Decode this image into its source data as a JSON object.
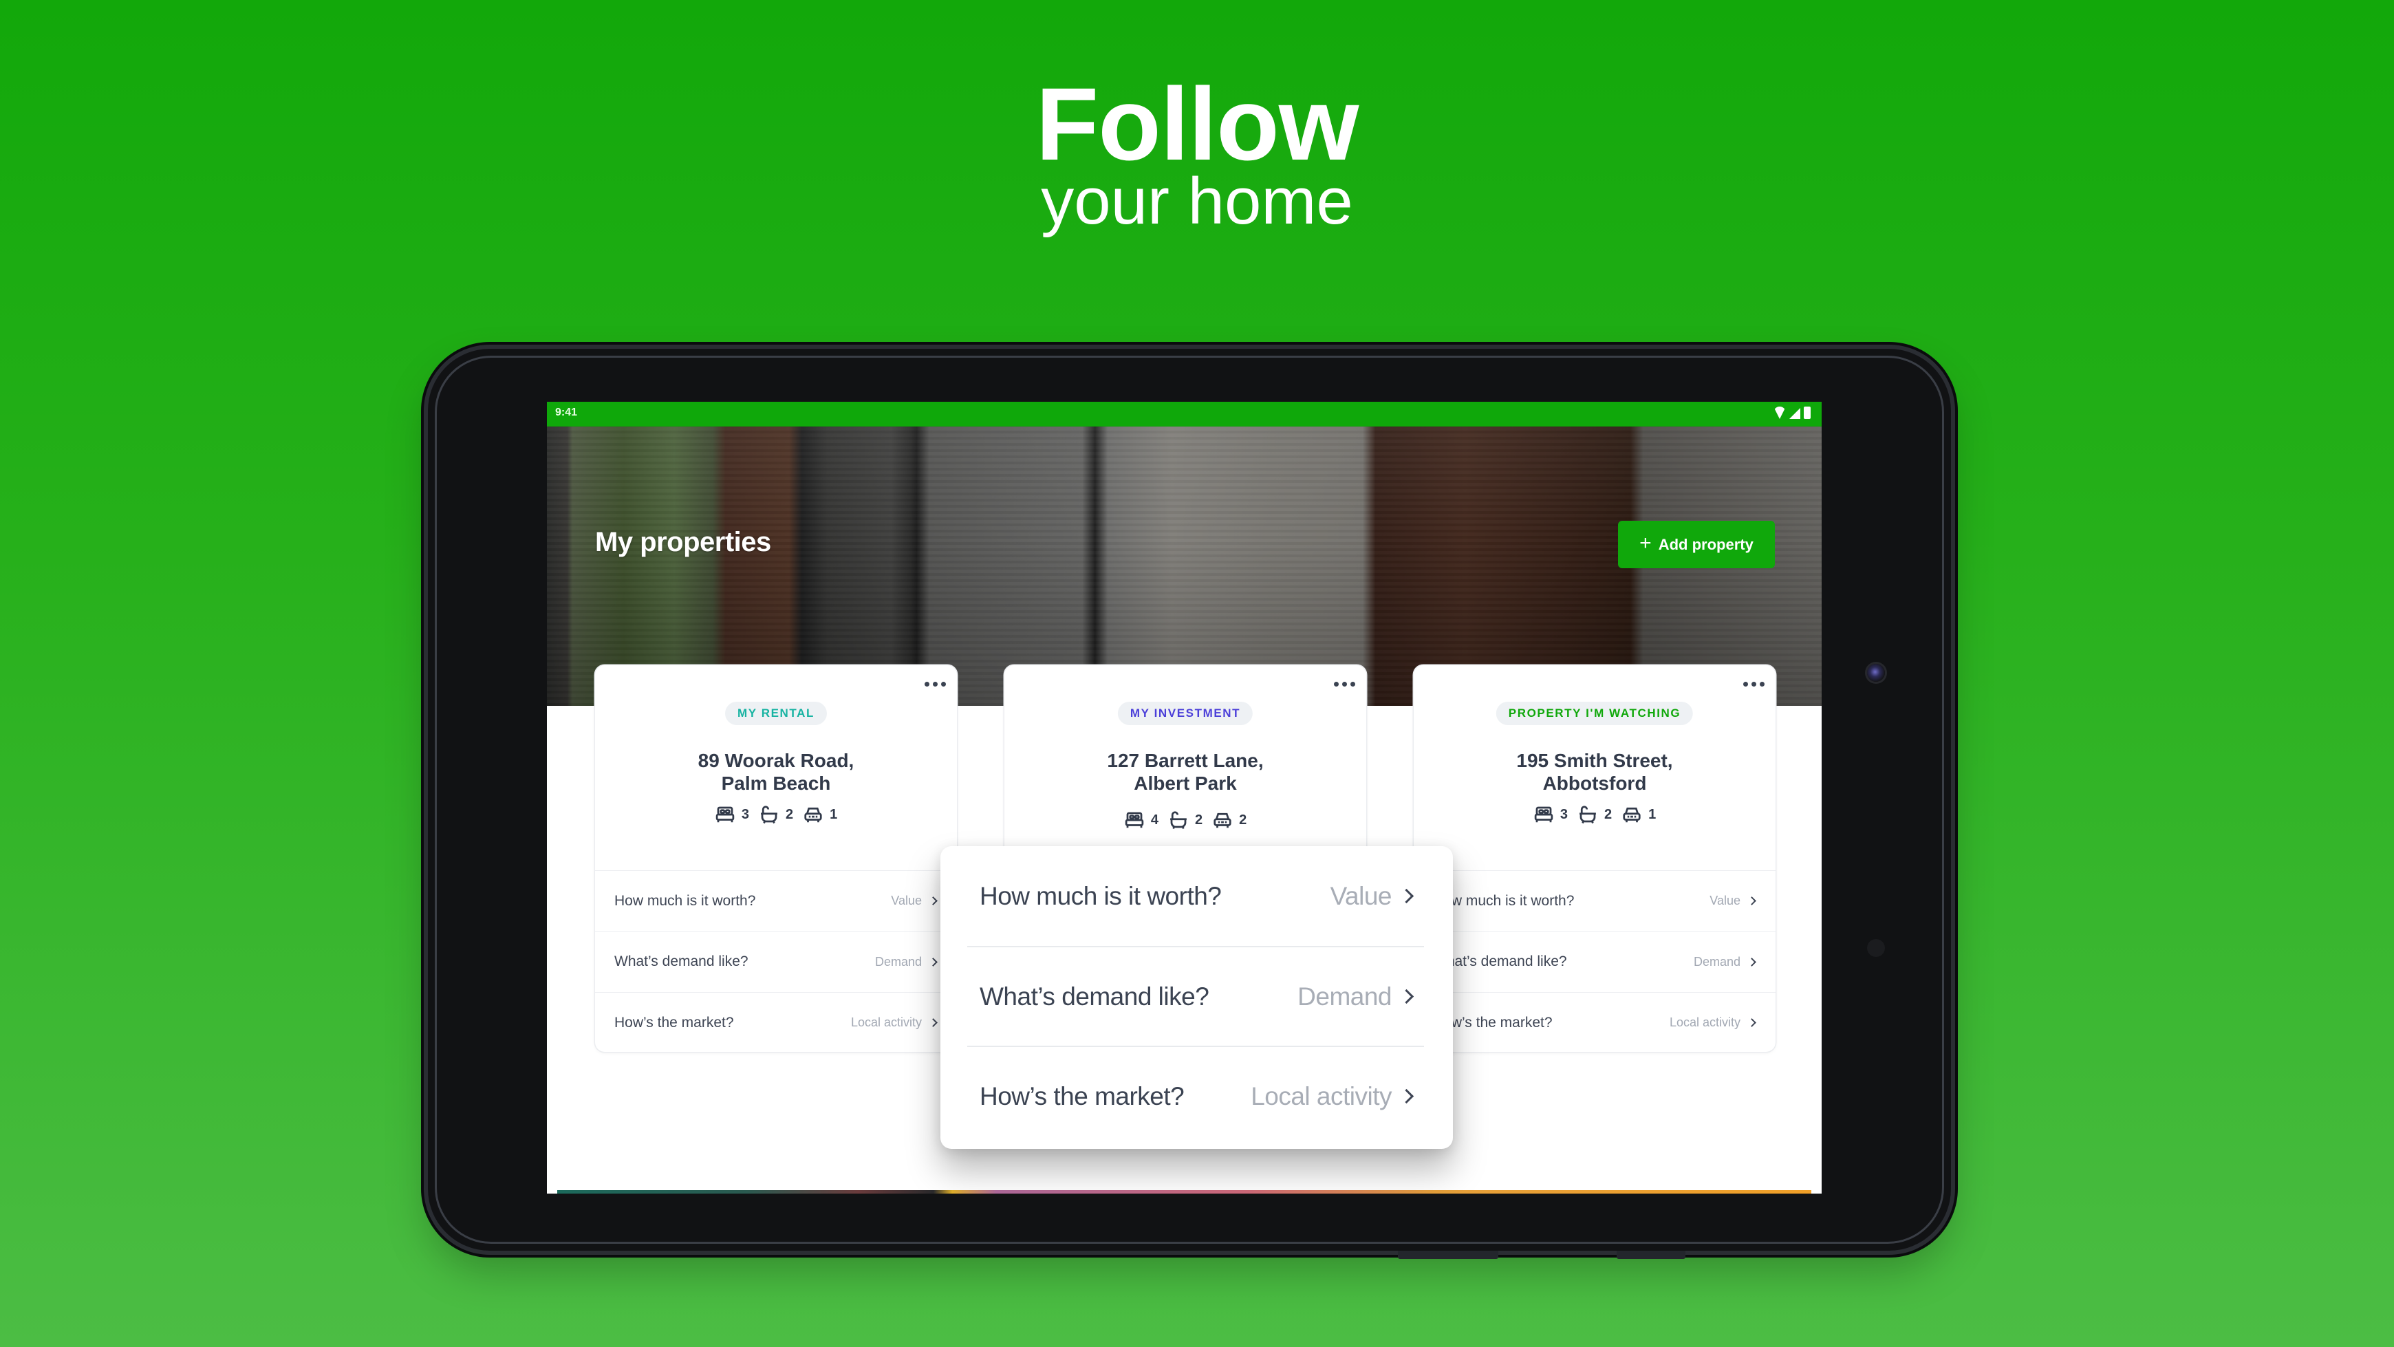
{
  "headline": {
    "title": "Follow",
    "subtitle": "your home"
  },
  "device": {
    "status_bar": {
      "time": "9:41",
      "icons": [
        "wifi-icon",
        "signal-icon",
        "battery-icon"
      ]
    }
  },
  "app": {
    "page_title": "My properties",
    "add_button": {
      "label": "Add property",
      "icon": "plus-icon"
    },
    "colors": {
      "brand_green": "#0fa80a",
      "tag_rental": "#17b3a2",
      "tag_investment": "#4b3fd9",
      "tag_watching": "#10a80b",
      "text_primary": "#323a4a",
      "text_muted": "#a2a8b3"
    },
    "properties": [
      {
        "tag": "MY RENTAL",
        "address_line1": "89 Woorak Road,",
        "address_line2": "Palm Beach",
        "beds": "3",
        "baths": "2",
        "cars": "1",
        "links": [
          {
            "question": "How much is it worth?",
            "action": "Value"
          },
          {
            "question": "What’s demand like?",
            "action": "Demand"
          },
          {
            "question": "How’s the market?",
            "action": "Local activity"
          }
        ]
      },
      {
        "tag": "MY INVESTMENT",
        "address_line1": "127 Barrett Lane,",
        "address_line2": "Albert Park",
        "beds": "4",
        "baths": "2",
        "cars": "2",
        "links": [
          {
            "question": "How much is it worth?",
            "action": "Value"
          },
          {
            "question": "What’s demand like?",
            "action": "Demand"
          },
          {
            "question": "How’s the market?",
            "action": "Local activity"
          }
        ]
      },
      {
        "tag": "PROPERTY I'M WATCHING",
        "address_line1": "195 Smith Street,",
        "address_line2": "Abbotsford",
        "beds": "3",
        "baths": "2",
        "cars": "1",
        "links": [
          {
            "question": "How much is it worth?",
            "action": "Value"
          },
          {
            "question": "What’s demand like?",
            "action": "Demand"
          },
          {
            "question": "How’s the market?",
            "action": "Local activity"
          }
        ]
      }
    ],
    "popup": {
      "items": [
        {
          "question": "How much is it worth?",
          "action": "Value"
        },
        {
          "question": "What’s demand like?",
          "action": "Demand"
        },
        {
          "question": "How’s the market?",
          "action": "Local activity"
        }
      ]
    }
  }
}
